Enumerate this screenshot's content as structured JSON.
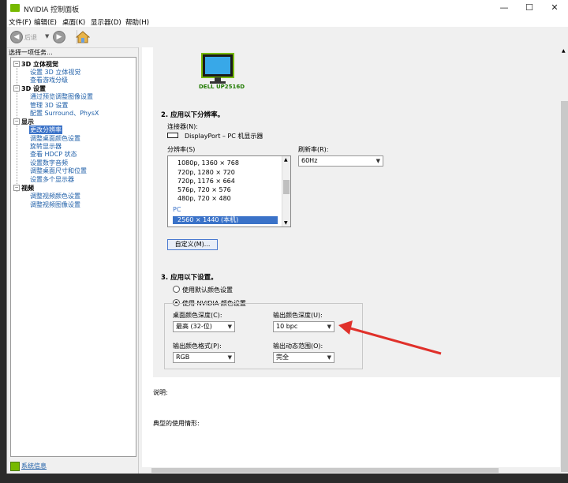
{
  "window": {
    "title": "NVIDIA 控制面板",
    "controls": [
      "—",
      "☐",
      "✕"
    ]
  },
  "menu": {
    "items": [
      "文件(F)",
      "编辑(E)",
      "桌面(K)",
      "显示器(D)",
      "帮助(H)"
    ]
  },
  "toolbar": {
    "back_label": "后退",
    "back_icon": "arrow-left-icon",
    "forward_icon": "arrow-right-icon",
    "home_icon": "home-icon"
  },
  "sidebar": {
    "header": "选择一项任务...",
    "tree": [
      {
        "type": "cat",
        "label": "3D 立体视觉"
      },
      {
        "type": "link",
        "label": "设置 3D 立体视觉"
      },
      {
        "type": "link",
        "label": "查看游戏分级"
      },
      {
        "type": "cat",
        "label": "3D 设置"
      },
      {
        "type": "link",
        "label": "通过预览调整图像设置"
      },
      {
        "type": "link",
        "label": "管理 3D 设置"
      },
      {
        "type": "link",
        "label": "配置 Surround、PhysX"
      },
      {
        "type": "cat",
        "label": "显示"
      },
      {
        "type": "selected",
        "label": "更改分辨率"
      },
      {
        "type": "link",
        "label": "调整桌面颜色设置"
      },
      {
        "type": "link",
        "label": "旋转显示器"
      },
      {
        "type": "link",
        "label": "查看 HDCP 状态"
      },
      {
        "type": "link",
        "label": "设置数字音频"
      },
      {
        "type": "link",
        "label": "调整桌面尺寸和位置"
      },
      {
        "type": "link",
        "label": "设置多个显示器"
      },
      {
        "type": "cat",
        "label": "视频"
      },
      {
        "type": "link",
        "label": "调整视频颜色设置"
      },
      {
        "type": "link",
        "label": "调整视频图像设置"
      }
    ],
    "system_info": "系统信息"
  },
  "main": {
    "monitor_name": "DELL UP2516D",
    "section2": {
      "title": "2. 应用以下分辨率。",
      "connector_label": "连接器(N):",
      "connector_value": "DisplayPort – PC 机显示器",
      "resolution_label": "分辨率(S)",
      "resolutions": [
        "1080p, 1360 × 768",
        "720p, 1280 × 720",
        "720p, 1176 × 664",
        "576p, 720 × 576",
        "480p, 720 × 480"
      ],
      "group_pc": "PC",
      "selected_resolution": "2560 × 1440 (本机)",
      "refresh_label": "刷新率(R):",
      "refresh_value": "60Hz",
      "custom_button": "自定义(M)..."
    },
    "section3": {
      "title": "3. 应用以下设置。",
      "radio_default": "使用默认颜色设置",
      "radio_nvidia": "使用 NVIDIA 颜色设置",
      "desktop_depth_label": "桌面颜色深度(C):",
      "desktop_depth_value": "最高 (32-位)",
      "output_depth_label": "输出颜色深度(U):",
      "output_depth_value": "10 bpc",
      "output_format_label": "输出颜色格式(P):",
      "output_format_value": "RGB",
      "dynamic_range_label": "输出动态范围(O):",
      "dynamic_range_value": "完全"
    },
    "description_label": "说明:",
    "typical_usage_label": "典型的使用情形:"
  },
  "colors": {
    "nvidia_green": "#76b900",
    "selection_blue": "#3a72c8",
    "link_blue": "#1f5fa8",
    "annotation_red": "#e0302a"
  }
}
